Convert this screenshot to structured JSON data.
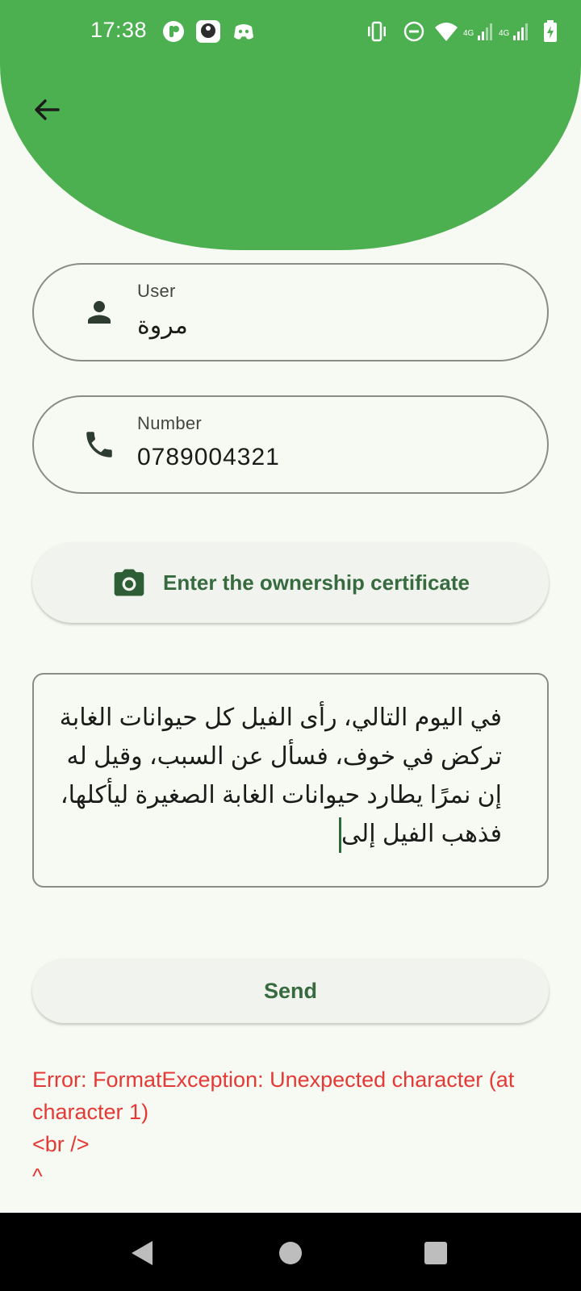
{
  "colors": {
    "header": "#4caf50",
    "background": "#f7f9f3",
    "accent": "#386a3f",
    "error": "#e53935"
  },
  "status_bar": {
    "time": "17:38",
    "left_icons": [
      "app-p-icon",
      "app-avatar-icon",
      "discord-icon"
    ],
    "right_icons": [
      "vibrate-icon",
      "dnd-icon",
      "wifi-icon",
      "signal-4g-1-icon",
      "signal-4g-2-icon",
      "battery-charging-icon"
    ]
  },
  "header": {
    "back_icon": "arrow-back-icon"
  },
  "user_field": {
    "label": "User",
    "value": "مروة",
    "icon": "person-icon"
  },
  "number_field": {
    "label": "Number",
    "value": "0789004321",
    "icon": "phone-icon"
  },
  "certificate_button": {
    "label": "Enter the ownership certificate",
    "icon": "camera-icon"
  },
  "story_input": {
    "value": "في اليوم التالي، رأى الفيل كل حيوانات الغابة تركض في خوف، فسأل عن السبب، وقيل له إن نمرًا يطارد حيوانات الغابة الصغيرة ليأكلها، فذهب الفيل إلى"
  },
  "send_button": {
    "label": "Send"
  },
  "error_message": "Error: FormatException: Unexpected character (at character 1)\n<br />\n^",
  "nav_bar": {
    "icons": [
      "nav-back-icon",
      "nav-home-icon",
      "nav-recents-icon"
    ]
  }
}
